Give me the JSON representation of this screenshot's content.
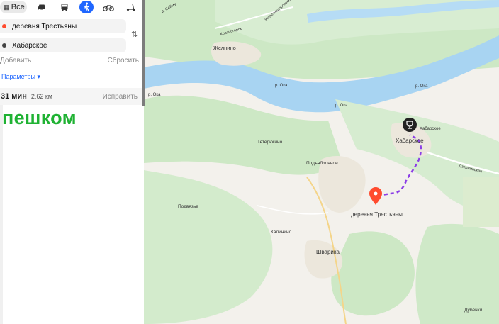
{
  "modes": {
    "all_label": "Все",
    "icons": [
      "car-icon",
      "bus-icon",
      "walk-icon",
      "bike-icon",
      "scooter-icon"
    ]
  },
  "route": {
    "from": "деревня Трестьяны",
    "to": "Хабарское"
  },
  "actions": {
    "add": "Добавить",
    "reset": "Сбросить"
  },
  "params_label": "Параметры ▾",
  "summary": {
    "time": "31 мин",
    "distance": "2.62 км",
    "fix": "Исправить"
  },
  "overlay_text": "пешком",
  "map": {
    "places": [
      "Желнино",
      "Хабарское",
      "Тетерюгино",
      "Подъяблонное",
      "деревня Трестьяны",
      "Подвязье",
      "Калинино",
      "Шварика",
      "Дубенки"
    ],
    "small_labels": [
      "Хабарское",
      "р. Ока",
      "р. Ока",
      "р. Ока",
      "р. Ока",
      "Красногорск",
      "Железнодорожная",
      "Дзержинская",
      "р. Сейму"
    ],
    "colors": {
      "water": "#a8d4f2",
      "forest": "#c8e6c0",
      "route": "#8c3fe6",
      "pin": "#ff4b2e",
      "accent": "#1f66ff",
      "green_text": "#1fb233"
    }
  }
}
